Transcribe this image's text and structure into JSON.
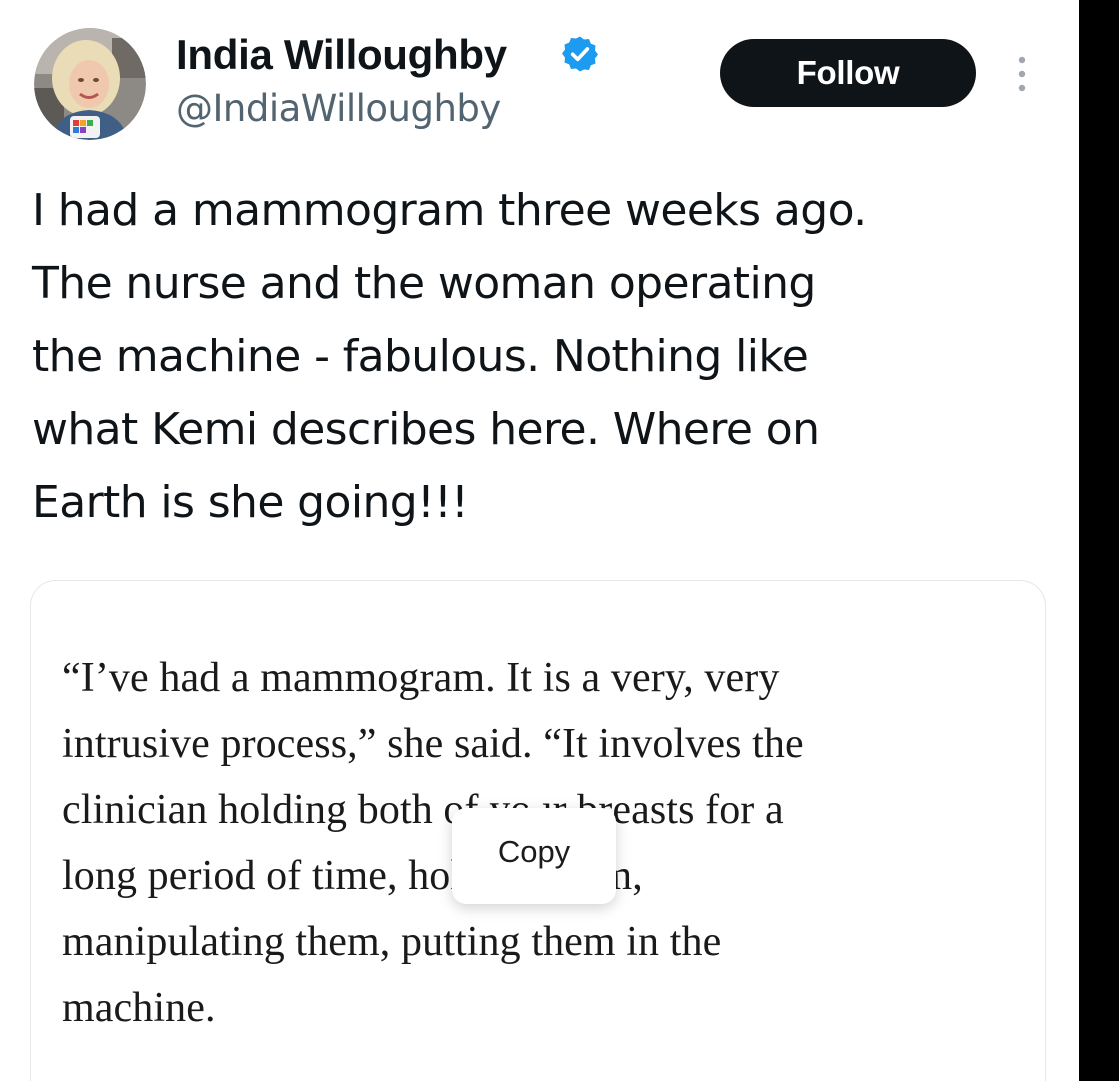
{
  "author": {
    "name": "India Willoughby",
    "handle": "@IndiaWilloughby",
    "verified": true,
    "avatar_icon": "profile-photo"
  },
  "header": {
    "follow_label": "Follow",
    "more_icon": "more-vertical-icon"
  },
  "tweet": {
    "lines": [
      "I had a mammogram three weeks ago.",
      "The nurse and the woman operating",
      "the machine - fabulous. Nothing like",
      "what Kemi describes here. Where on",
      "Earth is she going!!!"
    ]
  },
  "quote": {
    "lines": [
      "“I’ve had a mammogram. It is a very, very",
      "intrusive process,” she said. “It involves the",
      "clinician holding both of your breasts for a",
      "long period of time, holding them,",
      "manipulating them, putting them in the",
      "machine."
    ]
  },
  "context_menu": {
    "copy_label": "Copy"
  },
  "colors": {
    "text_primary": "#0f1419",
    "text_secondary": "#536471",
    "verified_blue": "#1d9bf0",
    "follow_bg": "#0f1419",
    "card_border": "#e4e7ea"
  }
}
